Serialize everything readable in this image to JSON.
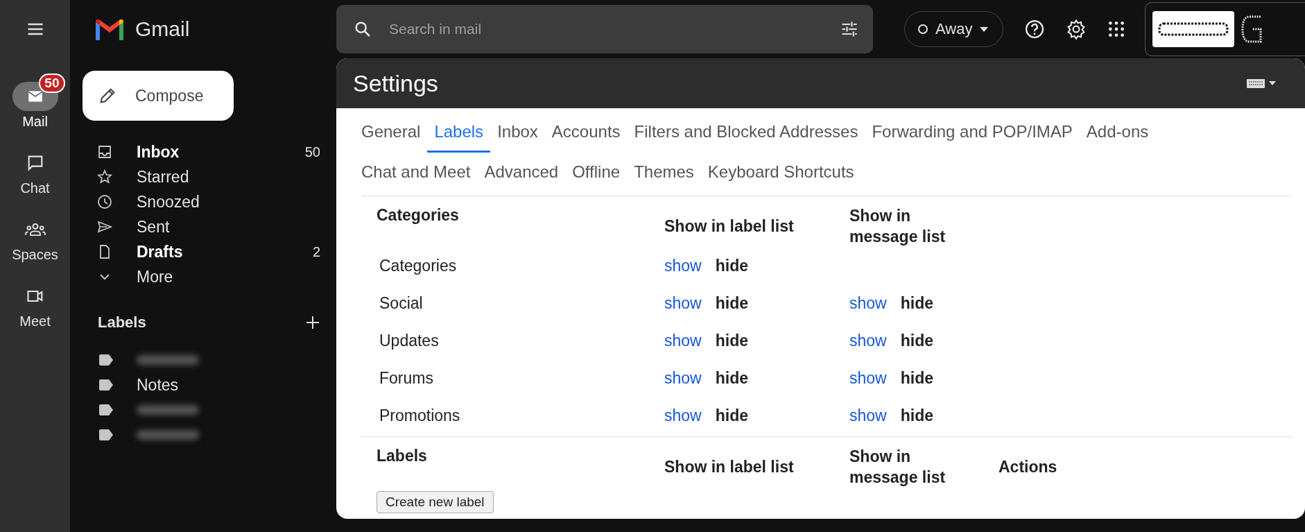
{
  "rail": {
    "items": [
      {
        "label": "Mail",
        "selected": true,
        "badge": "50"
      },
      {
        "label": "Chat",
        "selected": false
      },
      {
        "label": "Spaces",
        "selected": false
      },
      {
        "label": "Meet",
        "selected": false
      }
    ]
  },
  "app": {
    "name": "Gmail"
  },
  "compose": {
    "label": "Compose"
  },
  "folders": [
    {
      "label": "Inbox",
      "unread": true,
      "count": "50"
    },
    {
      "label": "Starred",
      "unread": false
    },
    {
      "label": "Snoozed",
      "unread": false
    },
    {
      "label": "Sent",
      "unread": false
    },
    {
      "label": "Drafts",
      "unread": true,
      "count": "2"
    },
    {
      "label": "More",
      "unread": false
    }
  ],
  "labels": {
    "title": "Labels",
    "items": [
      {
        "kind": "blurred"
      },
      {
        "kind": "text",
        "name": "Notes"
      },
      {
        "kind": "blurred"
      },
      {
        "kind": "blurred"
      }
    ]
  },
  "search": {
    "placeholder": "Search in mail"
  },
  "status": {
    "label": "Away"
  },
  "settings": {
    "title": "Settings",
    "tabs": [
      {
        "label": "General",
        "selected": false
      },
      {
        "label": "Labels",
        "selected": true
      },
      {
        "label": "Inbox",
        "selected": false
      },
      {
        "label": "Accounts",
        "selected": false
      },
      {
        "label": "Filters and Blocked Addresses",
        "selected": false
      },
      {
        "label": "Forwarding and POP/IMAP",
        "selected": false
      },
      {
        "label": "Add-ons",
        "selected": false
      },
      {
        "label": "Chat and Meet",
        "selected": false
      },
      {
        "label": "Advanced",
        "selected": false
      },
      {
        "label": "Offline",
        "selected": false
      },
      {
        "label": "Themes",
        "selected": false
      },
      {
        "label": "Keyboard Shortcuts",
        "selected": false
      }
    ],
    "categories": {
      "heading": "Categories",
      "columns": [
        "Show in label list",
        "Show in message list"
      ],
      "rows": [
        {
          "name": "Categories",
          "label_list": [
            {
              "text": "show",
              "selected": false
            },
            {
              "text": "hide",
              "selected": true
            }
          ]
        },
        {
          "name": "Social",
          "label_list": [
            {
              "text": "show",
              "selected": false
            },
            {
              "text": "hide",
              "selected": true
            }
          ],
          "message_list": [
            {
              "text": "show",
              "selected": false
            },
            {
              "text": "hide",
              "selected": true
            }
          ]
        },
        {
          "name": "Updates",
          "label_list": [
            {
              "text": "show",
              "selected": false
            },
            {
              "text": "hide",
              "selected": true
            }
          ],
          "message_list": [
            {
              "text": "show",
              "selected": false
            },
            {
              "text": "hide",
              "selected": true
            }
          ]
        },
        {
          "name": "Forums",
          "label_list": [
            {
              "text": "show",
              "selected": false
            },
            {
              "text": "hide",
              "selected": true
            }
          ],
          "message_list": [
            {
              "text": "show",
              "selected": false
            },
            {
              "text": "hide",
              "selected": true
            }
          ]
        },
        {
          "name": "Promotions",
          "label_list": [
            {
              "text": "show",
              "selected": false
            },
            {
              "text": "hide",
              "selected": true
            }
          ],
          "message_list": [
            {
              "text": "show",
              "selected": false
            },
            {
              "text": "hide",
              "selected": true
            }
          ]
        }
      ]
    },
    "labels": {
      "heading": "Labels",
      "columns": [
        "Show in label list",
        "Show in message list",
        "Actions"
      ],
      "button": "Create new label"
    }
  }
}
